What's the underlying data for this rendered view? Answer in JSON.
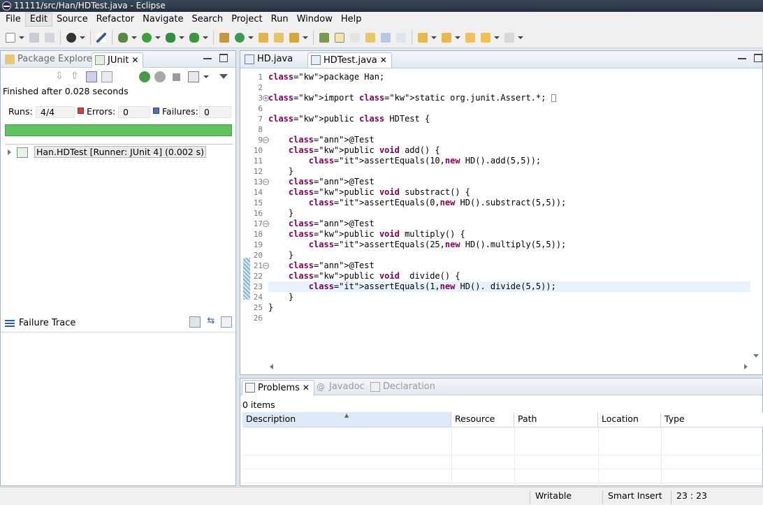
{
  "window": {
    "title": "11111/src/Han/HDTest.java - Eclipse"
  },
  "menu": [
    "File",
    "Edit",
    "Source",
    "Refactor",
    "Navigate",
    "Search",
    "Project",
    "Run",
    "Window",
    "Help"
  ],
  "left_panel": {
    "tab_package_explorer": "Package Explorer",
    "tab_junit": "JUnit",
    "finished": "Finished after 0.028 seconds",
    "runs_label": "Runs:",
    "runs_value": "4/4",
    "errors_label": "Errors:",
    "errors_value": "0",
    "failures_label": "Failures:",
    "failures_value": "0",
    "progress_fraction": 1.0,
    "test_result": "Han.HDTest [Runner: JUnit 4] (0.002 s)",
    "failure_trace": "Failure Trace"
  },
  "editor": {
    "tab_hd": "HD.java",
    "tab_hdtest": "HDTest.java",
    "lines": [
      {
        "n": "1",
        "code": "package Han;"
      },
      {
        "n": "2",
        "code": ""
      },
      {
        "n": "3",
        "code": "import static org.junit.Assert.*;"
      },
      {
        "n": "6",
        "code": ""
      },
      {
        "n": "7",
        "code": "public class HDTest {"
      },
      {
        "n": "8",
        "code": ""
      },
      {
        "n": "9",
        "code": "    @Test"
      },
      {
        "n": "10",
        "code": "    public void add() {"
      },
      {
        "n": "11",
        "code": "        assertEquals(10,new HD().add(5,5));"
      },
      {
        "n": "12",
        "code": "    }"
      },
      {
        "n": "13",
        "code": "    @Test"
      },
      {
        "n": "14",
        "code": "    public void substract() {"
      },
      {
        "n": "15",
        "code": "        assertEquals(0,new HD().substract(5,5));"
      },
      {
        "n": "16",
        "code": "    }"
      },
      {
        "n": "17",
        "code": "    @Test"
      },
      {
        "n": "18",
        "code": "    public void multiply() {"
      },
      {
        "n": "19",
        "code": "        assertEquals(25,new HD().multiply(5,5));"
      },
      {
        "n": "20",
        "code": "    }"
      },
      {
        "n": "21",
        "code": "    @Test"
      },
      {
        "n": "22",
        "code": "    public void  divide() {"
      },
      {
        "n": "23",
        "code": "        assertEquals(1,new HD(). divide(5,5));"
      },
      {
        "n": "24",
        "code": "    }"
      },
      {
        "n": "25",
        "code": "}"
      },
      {
        "n": "26",
        "code": ""
      }
    ]
  },
  "problems": {
    "tab_problems": "Problems",
    "tab_javadoc": "Javadoc",
    "tab_declaration": "Declaration",
    "items": "0 items",
    "columns": [
      "Description",
      "Resource",
      "Path",
      "Location",
      "Type"
    ]
  },
  "status": {
    "writable": "Writable",
    "insert_mode": "Smart Insert",
    "position": "23 : 23"
  },
  "colors": {
    "success": "#5fc35f",
    "keyword": "#7f0055",
    "annotation": "#646464"
  }
}
